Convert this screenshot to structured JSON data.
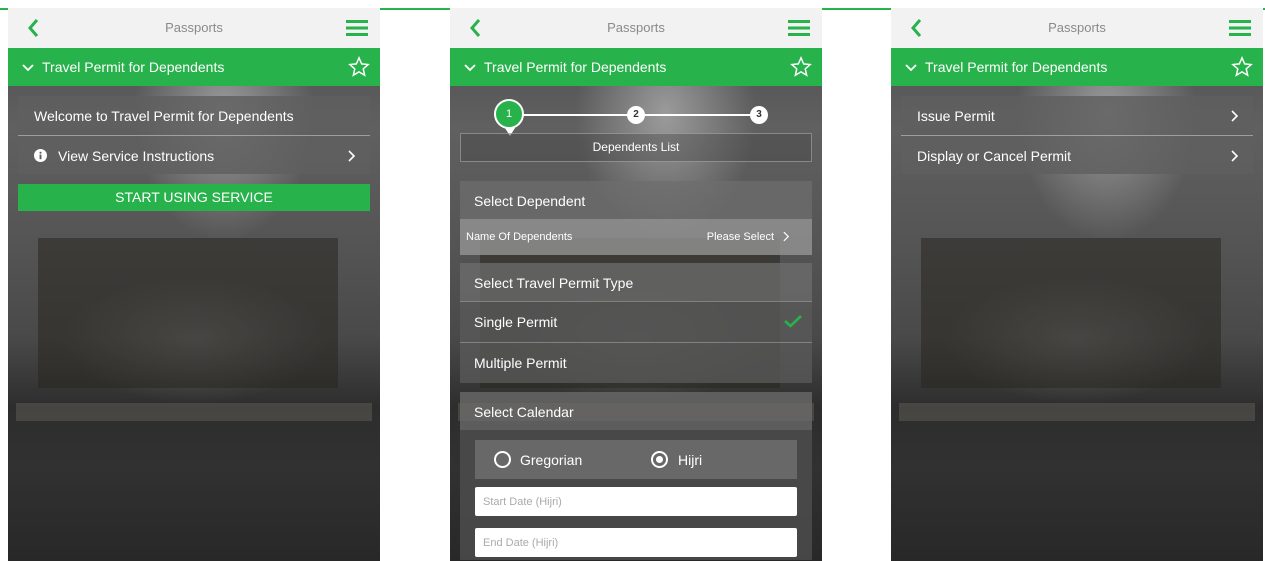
{
  "colors": {
    "brand_green": "#27b24b",
    "topbar_bg": "#f2f2f2"
  },
  "icons": [
    "back-chevron-icon",
    "hamburger-menu-icon",
    "chevron-down-icon",
    "star-outline-icon",
    "chevron-right-icon",
    "info-icon",
    "checkmark-icon"
  ],
  "screens": [
    {
      "topbar": {
        "title": "Passports"
      },
      "service_title": "Travel Permit for Dependents",
      "items": [
        {
          "label": "Welcome to Travel Permit for Dependents"
        },
        {
          "label": "View Service Instructions"
        }
      ],
      "start_button": "START USING SERVICE"
    },
    {
      "topbar": {
        "title": "Passports"
      },
      "service_title": "Travel Permit for Dependents",
      "steps": [
        "1",
        "2",
        "3"
      ],
      "current_step_label": "Dependents List",
      "select_dependent": {
        "header": "Select Dependent",
        "field_label": "Name Of Dependents",
        "field_value": "Please Select"
      },
      "permit_type": {
        "header": "Select Travel Permit Type",
        "options": [
          {
            "label": "Single Permit",
            "selected": true
          },
          {
            "label": "Multiple Permit",
            "selected": false
          }
        ]
      },
      "calendar": {
        "header": "Select Calendar",
        "options": [
          {
            "label": "Gregorian",
            "selected": false
          },
          {
            "label": "Hijri",
            "selected": true
          }
        ],
        "start_placeholder": "Start Date (Hijri)",
        "end_placeholder": "End Date (Hijri)"
      }
    },
    {
      "topbar": {
        "title": "Passports"
      },
      "service_title": "Travel Permit for Dependents",
      "items": [
        {
          "label": "Issue Permit"
        },
        {
          "label": "Display or Cancel Permit"
        }
      ]
    }
  ]
}
